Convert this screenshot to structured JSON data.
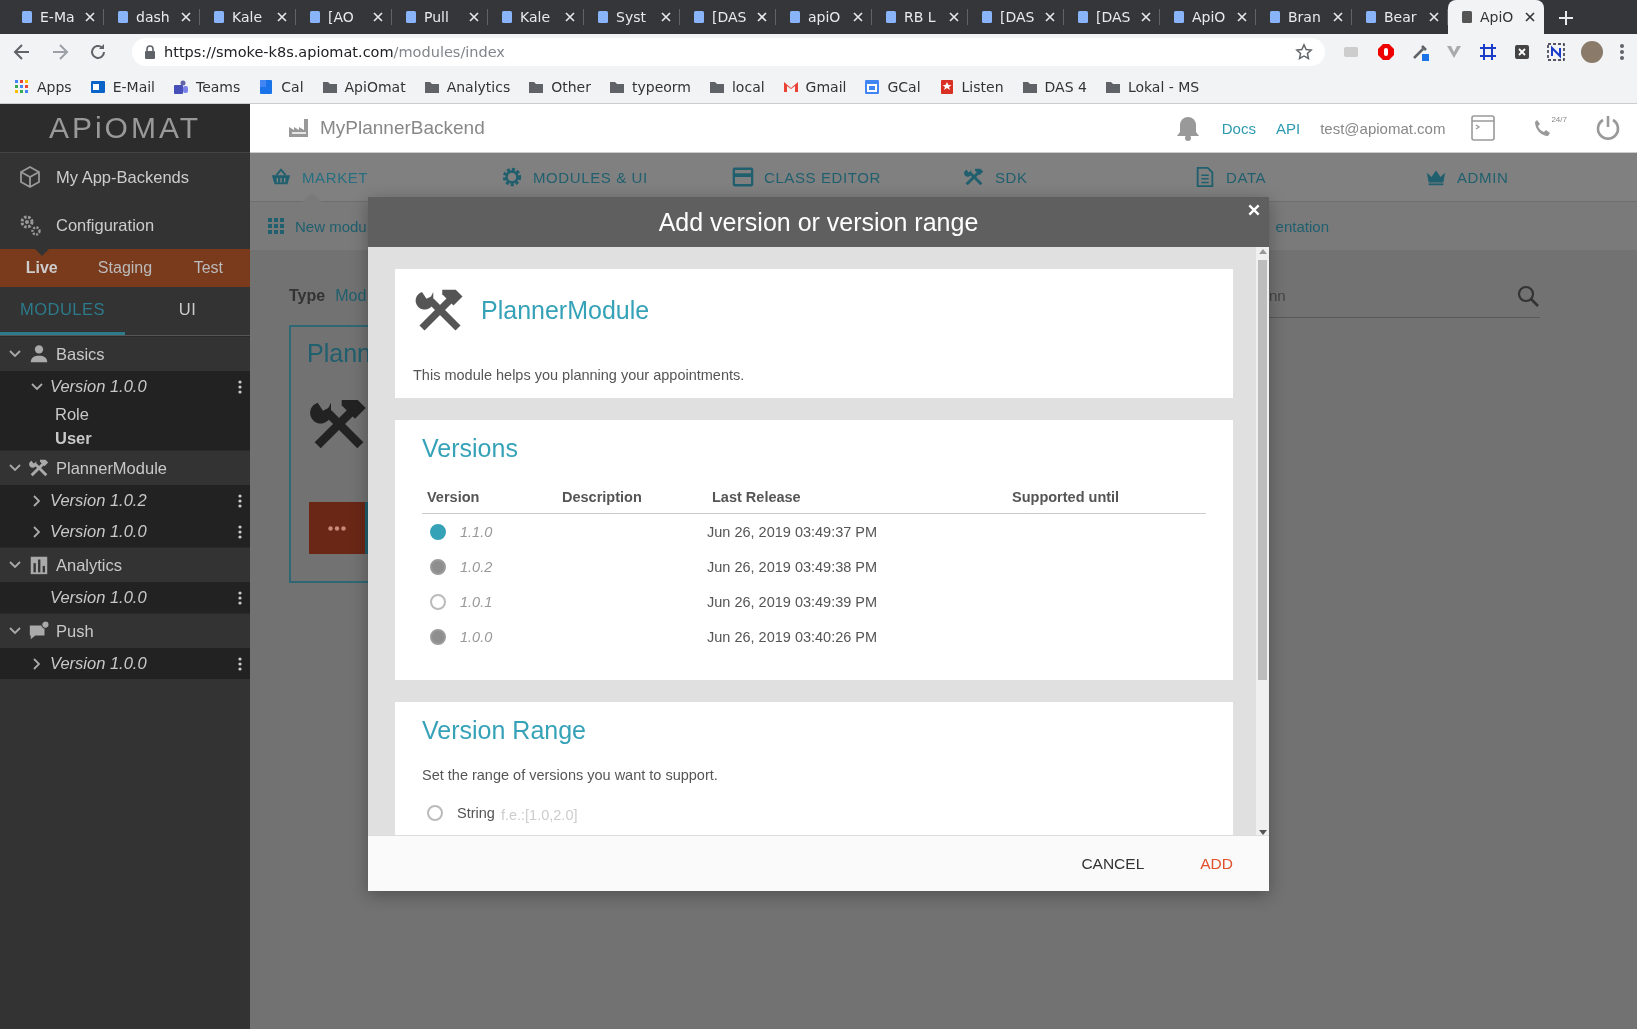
{
  "browser": {
    "tabs": [
      {
        "title": "E-Ma",
        "selected": false
      },
      {
        "title": "dash",
        "selected": false
      },
      {
        "title": "Kale",
        "selected": false
      },
      {
        "title": "[AO",
        "selected": false
      },
      {
        "title": "Pull",
        "selected": false
      },
      {
        "title": "Kale",
        "selected": false
      },
      {
        "title": "Syst",
        "selected": false
      },
      {
        "title": "[DAS",
        "selected": false
      },
      {
        "title": "apiO",
        "selected": false
      },
      {
        "title": "RB L",
        "selected": false
      },
      {
        "title": "[DAS",
        "selected": false
      },
      {
        "title": "[DAS",
        "selected": false
      },
      {
        "title": "ApiO",
        "selected": false
      },
      {
        "title": "Bran",
        "selected": false
      },
      {
        "title": "Bear",
        "selected": false
      },
      {
        "title": "ApiO",
        "selected": true
      }
    ],
    "url": {
      "host": "https://smoke-k8s.apiomat.com",
      "path": "/modules/index"
    },
    "bookmarks": [
      {
        "label": "Apps",
        "kind": "apps"
      },
      {
        "label": "E-Mail",
        "kind": "mail"
      },
      {
        "label": "Teams",
        "kind": "teams"
      },
      {
        "label": "Cal",
        "kind": "cal"
      },
      {
        "label": "ApiOmat",
        "kind": "folder"
      },
      {
        "label": "Analytics",
        "kind": "folder"
      },
      {
        "label": "Other",
        "kind": "folder"
      },
      {
        "label": "typeorm",
        "kind": "folder"
      },
      {
        "label": "local",
        "kind": "folder"
      },
      {
        "label": "Gmail",
        "kind": "gmail"
      },
      {
        "label": "GCal",
        "kind": "gcal"
      },
      {
        "label": "Listen",
        "kind": "listen"
      },
      {
        "label": "DAS 4",
        "kind": "folder"
      },
      {
        "label": "Lokal - MS",
        "kind": "folder"
      }
    ]
  },
  "sidebar": {
    "logo": "APiOMAT",
    "menu": [
      {
        "label": "My App-Backends",
        "kind": "cube"
      },
      {
        "label": "Configuration",
        "kind": "gears"
      }
    ],
    "environments": [
      {
        "label": "Live",
        "selected": true
      },
      {
        "label": "Staging",
        "selected": false
      },
      {
        "label": "Test",
        "selected": false
      }
    ],
    "sections": [
      {
        "label": "MODULES",
        "selected": true
      },
      {
        "label": "UI",
        "selected": false
      }
    ],
    "modules": [
      {
        "label": "Basics",
        "kind": "person",
        "expanded": true,
        "children": [
          {
            "label": "Version 1.0.0",
            "expanded": true,
            "children": [
              {
                "label": "Role",
                "selected": false
              },
              {
                "label": "User",
                "selected": true
              }
            ]
          }
        ]
      },
      {
        "label": "PlannerModule",
        "kind": "tools",
        "expanded": true,
        "children": [
          {
            "label": "Version 1.0.2",
            "expanded": false
          },
          {
            "label": "Version 1.0.0",
            "expanded": false
          }
        ]
      },
      {
        "label": "Analytics",
        "kind": "bars",
        "expanded": true,
        "children": [
          {
            "label": "Version 1.0.0"
          }
        ]
      },
      {
        "label": "Push",
        "kind": "chat",
        "expanded": true,
        "children": [
          {
            "label": "Version 1.0.0",
            "expanded": false
          }
        ]
      }
    ]
  },
  "header": {
    "app_name": "MyPlannerBackend",
    "links": [
      "Docs",
      "API"
    ],
    "user": "test@apiomat.com",
    "support_badge": "24/7"
  },
  "nav": [
    {
      "label": "MARKET",
      "kind": "basket",
      "selected": true
    },
    {
      "label": "MODULES & UI",
      "kind": "gear",
      "selected": false
    },
    {
      "label": "CLASS EDITOR",
      "kind": "window",
      "selected": false
    },
    {
      "label": "SDK",
      "kind": "tools",
      "selected": false
    },
    {
      "label": "DATA",
      "kind": "doc",
      "selected": false
    },
    {
      "label": "ADMIN",
      "kind": "crown",
      "selected": false
    }
  ],
  "subnav": {
    "left": "New modu",
    "right": "entation"
  },
  "content": {
    "type_label": "Type",
    "type_value": "Mod",
    "search_value": "nn",
    "card_title": "Plann"
  },
  "dialog": {
    "title": "Add version or version range",
    "module": {
      "name": "PlannerModule",
      "description": "This module helps you planning your appointments."
    },
    "versions": {
      "title": "Versions",
      "columns": [
        "Version",
        "Description",
        "Last Release",
        "Supported until"
      ],
      "rows": [
        {
          "version": "1.1.0",
          "last_release": "Jun 26, 2019 03:49:37 PM",
          "selected": true,
          "disabled": false
        },
        {
          "version": "1.0.2",
          "last_release": "Jun 26, 2019 03:49:38 PM",
          "selected": false,
          "disabled": true
        },
        {
          "version": "1.0.1",
          "last_release": "Jun 26, 2019 03:49:39 PM",
          "selected": false,
          "disabled": false
        },
        {
          "version": "1.0.0",
          "last_release": "Jun 26, 2019 03:40:26 PM",
          "selected": false,
          "disabled": true
        }
      ]
    },
    "range": {
      "title": "Version Range",
      "description": "Set the range of versions you want to support.",
      "options": [
        {
          "label": "String",
          "placeholder": "f.e.:[1.0,2.0]",
          "selected": false
        }
      ]
    },
    "buttons": [
      {
        "label": "CANCEL",
        "kind": "cancel"
      },
      {
        "label": "ADD",
        "kind": "primary"
      }
    ]
  }
}
